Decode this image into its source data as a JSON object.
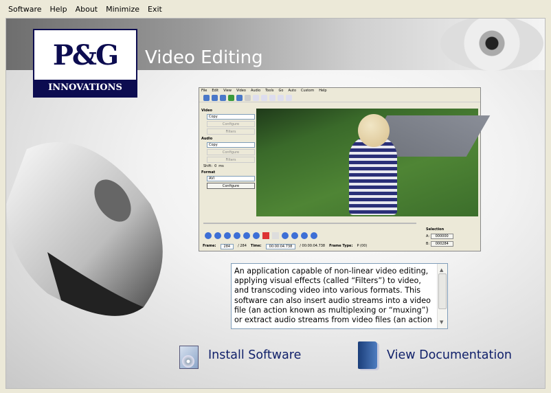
{
  "menu": [
    "Software",
    "Help",
    "About",
    "Minimize",
    "Exit"
  ],
  "logo": {
    "top": "P&G",
    "bottom": "INNOVATIONS"
  },
  "title": "Video Editing",
  "screenshot": {
    "menu": [
      "File",
      "Edit",
      "View",
      "Video",
      "Audio",
      "Tools",
      "Go",
      "Auto",
      "Custom",
      "Help"
    ],
    "video_label": "Video",
    "video_codec": "Copy",
    "configure": "Configure",
    "filters": "Filters",
    "audio_label": "Audio",
    "audio_codec": "Copy",
    "shift_label": "Shift:",
    "shift_value": "0",
    "shift_unit": "ms",
    "format_label": "Format",
    "format_value": "AVI",
    "frame_label": "Frame:",
    "frame_value": "284",
    "frame_total": "/ 284",
    "time_label": "Time:",
    "time_value": "00:00:04.738",
    "time_total": "/ 00:00:04.738",
    "frame_type_label": "Frame Type:",
    "frame_type_value": "P (00)",
    "selection_label": "Selection",
    "a_label": "A:",
    "a_value": "000000",
    "b_label": "B:",
    "b_value": "000284"
  },
  "description": "An application capable of non-linear video editing, applying visual effects (called “Filters”) to video, and transcoding video into various formats.  This software can also insert audio streams into a video file (an action known as multiplexing or “muxing”) or extract audio streams from video files (an action",
  "actions": {
    "install": "Install Software",
    "docs": "View Documentation"
  },
  "colors": {
    "brand_navy": "#0c0c50",
    "action_text": "#10206a"
  }
}
